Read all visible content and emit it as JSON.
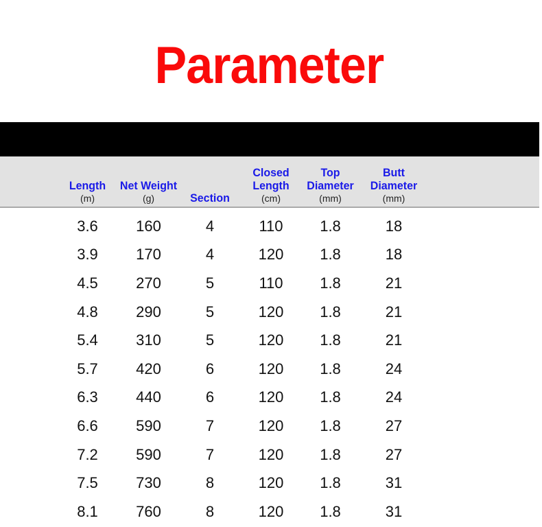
{
  "page": {
    "title": "Parameter",
    "title_color": "#fa0a0a",
    "header_text_color": "#1a1ae8",
    "header_band_color": "#e2e2e2",
    "divider_bar_color": "#000000",
    "background_color": "#ffffff"
  },
  "table": {
    "columns": [
      {
        "name": "Length",
        "unit": "(m)"
      },
      {
        "name": "Net Weight",
        "unit": "(g)"
      },
      {
        "name": "Section",
        "unit": ""
      },
      {
        "name": "Closed Length",
        "unit": "(cm)"
      },
      {
        "name": "Top Diameter",
        "unit": "(mm)"
      },
      {
        "name": "Butt Diameter",
        "unit": "(mm)"
      }
    ],
    "rows": [
      {
        "length": "3.6",
        "net_weight": "160",
        "section": "4",
        "closed_length": "110",
        "top_diameter": "1.8",
        "butt_diameter": "18"
      },
      {
        "length": "3.9",
        "net_weight": "170",
        "section": "4",
        "closed_length": "120",
        "top_diameter": "1.8",
        "butt_diameter": "18"
      },
      {
        "length": "4.5",
        "net_weight": "270",
        "section": "5",
        "closed_length": "110",
        "top_diameter": "1.8",
        "butt_diameter": "21"
      },
      {
        "length": "4.8",
        "net_weight": "290",
        "section": "5",
        "closed_length": "120",
        "top_diameter": "1.8",
        "butt_diameter": "21"
      },
      {
        "length": "5.4",
        "net_weight": "310",
        "section": "5",
        "closed_length": "120",
        "top_diameter": "1.8",
        "butt_diameter": "21"
      },
      {
        "length": "5.7",
        "net_weight": "420",
        "section": "6",
        "closed_length": "120",
        "top_diameter": "1.8",
        "butt_diameter": "24"
      },
      {
        "length": "6.3",
        "net_weight": "440",
        "section": "6",
        "closed_length": "120",
        "top_diameter": "1.8",
        "butt_diameter": "24"
      },
      {
        "length": "6.6",
        "net_weight": "590",
        "section": "7",
        "closed_length": "120",
        "top_diameter": "1.8",
        "butt_diameter": "27"
      },
      {
        "length": "7.2",
        "net_weight": "590",
        "section": "7",
        "closed_length": "120",
        "top_diameter": "1.8",
        "butt_diameter": "27"
      },
      {
        "length": "7.5",
        "net_weight": "730",
        "section": "8",
        "closed_length": "120",
        "top_diameter": "1.8",
        "butt_diameter": "31"
      },
      {
        "length": "8.1",
        "net_weight": "760",
        "section": "8",
        "closed_length": "120",
        "top_diameter": "1.8",
        "butt_diameter": "31"
      }
    ]
  }
}
